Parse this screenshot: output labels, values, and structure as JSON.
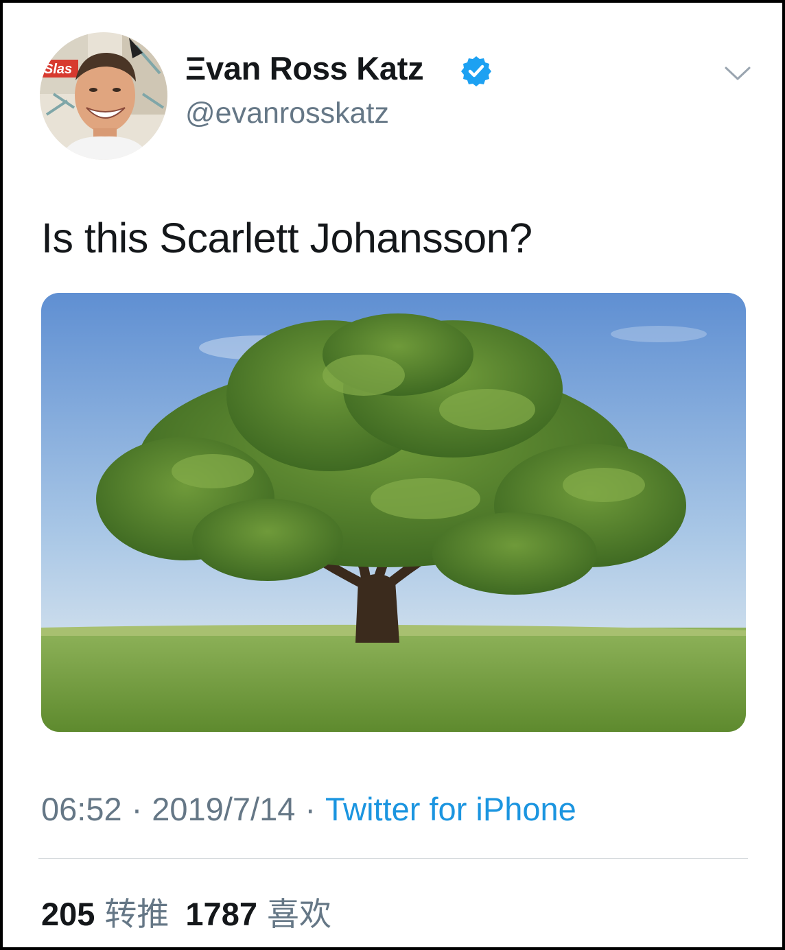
{
  "tweet": {
    "author": {
      "display_name": "Ξvan Ross Katz",
      "handle": "@evanrosskatz",
      "verified": true,
      "avatar_label": "Slas"
    },
    "text": "Is this Scarlett Johansson?",
    "media": {
      "description_icon": "photo-tree-in-field"
    },
    "meta": {
      "time": "06:52",
      "separator": "·",
      "date": "2019/7/14",
      "source": "Twitter for iPhone"
    },
    "stats": {
      "retweets_count": "205",
      "retweets_label": "转推",
      "likes_count": "1787",
      "likes_label": "喜欢"
    }
  },
  "colors": {
    "primary_text": "#14171a",
    "secondary_text": "#657786",
    "link": "#1b95e0",
    "verified_badge": "#1da1f2"
  }
}
